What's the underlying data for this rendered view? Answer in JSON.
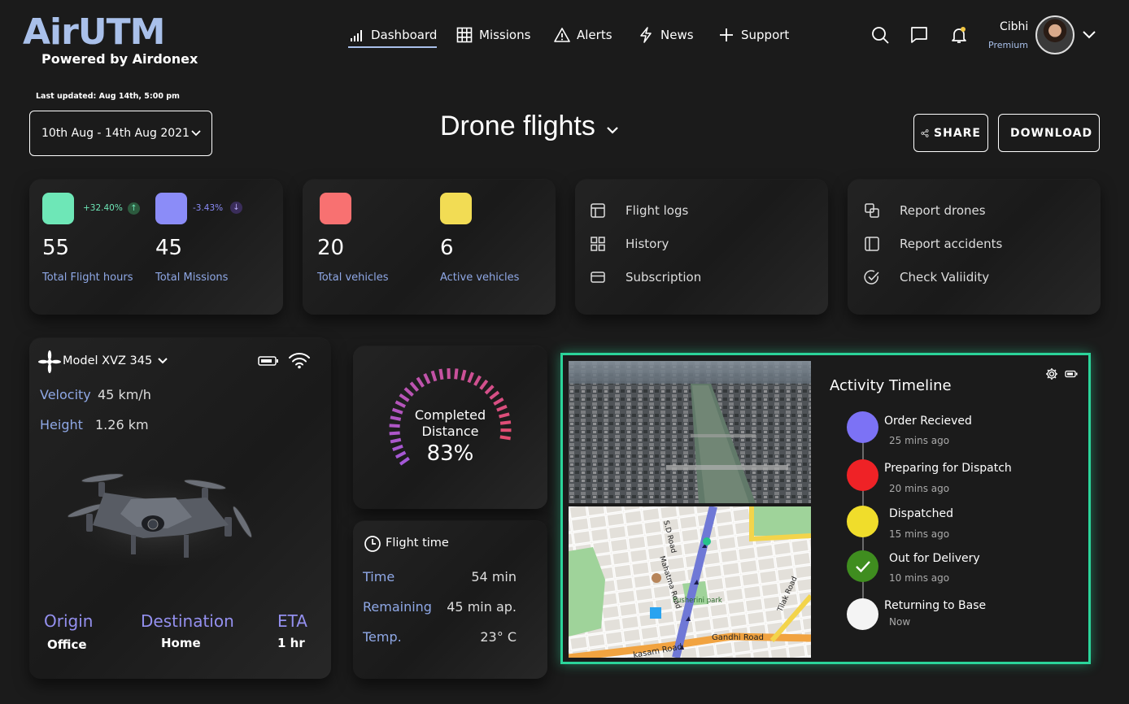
{
  "brand": {
    "logo": "AirUTM",
    "powered_by": "Powered by Airdonex"
  },
  "nav": [
    {
      "label": "Dashboard",
      "icon": "bar-chart-icon",
      "active": true
    },
    {
      "label": "Missions",
      "icon": "grid-icon"
    },
    {
      "label": "Alerts",
      "icon": "warning-icon"
    },
    {
      "label": "News",
      "icon": "lightning-icon"
    },
    {
      "label": "Support",
      "icon": "plus-icon"
    }
  ],
  "user": {
    "name": "Cibhi",
    "tier": "Premium"
  },
  "last_updated": "Last updated:  Aug 14th, 5:00 pm",
  "date_range": "10th Aug - 14th Aug 2021",
  "title": "Drone flights",
  "actions": {
    "share": "SHARE",
    "download": "DOWNLOAD"
  },
  "stats": {
    "flight_hours": {
      "value": "55",
      "label": "Total Flight  hours",
      "change": "+32.40%",
      "color": "#6ee7b7"
    },
    "missions": {
      "value": "45",
      "label": "Total  Missions",
      "change": "-3.43%",
      "color": "#8b8cf8"
    },
    "vehicles": {
      "value": "20",
      "label": "Total vehicles",
      "color": "#f87171"
    },
    "active": {
      "value": "6",
      "label": "Active vehicles",
      "color": "#f2dc54"
    }
  },
  "menu_a": [
    "Flight logs",
    "History",
    "Subscription"
  ],
  "menu_b": [
    "Report drones",
    "Report accidents",
    "Check Valiidity"
  ],
  "drone": {
    "model": "Model XVZ 345",
    "velocity_label": "Velocity",
    "velocity": "45 km/h",
    "height_label": "Height",
    "height": "1.26 km",
    "origin_label": "Origin",
    "origin": "Office",
    "dest_label": "Destination",
    "dest": "Home",
    "eta_label": "ETA",
    "eta": "1 hr"
  },
  "distance": {
    "label1": "Completed",
    "label2": "Distance",
    "value": "83%",
    "percent": 83
  },
  "flight_time": {
    "title": "Flight time",
    "rows": [
      {
        "label": "Time",
        "value": "54 min"
      },
      {
        "label": "Remaining",
        "value": "45 min ap."
      },
      {
        "label": "Temp.",
        "value": "23° C"
      }
    ]
  },
  "map": {
    "labels": {
      "sd_road": "S.D Road",
      "mahatma": "Mahatma Road",
      "park": "Pusherini park",
      "tilak": "Tilak Road",
      "gandhi": "Gandhi Road",
      "kasam": "kasam Road"
    }
  },
  "timeline": {
    "title": "Activity Timeline",
    "items": [
      {
        "title": "Order Recieved",
        "time": "25 mins ago",
        "color": "#7c72f5"
      },
      {
        "title": "Preparing for Dispatch",
        "time": "20 mins ago",
        "color": "#ef2226"
      },
      {
        "title": "Dispatched",
        "time": "15 mins ago",
        "color": "#f0dd2b"
      },
      {
        "title": "Out for Delivery",
        "time": "10 mins ago",
        "color": "#3f8d1f"
      },
      {
        "title": "Returning to Base",
        "time": "Now",
        "color": "#f4f4f4"
      }
    ]
  }
}
